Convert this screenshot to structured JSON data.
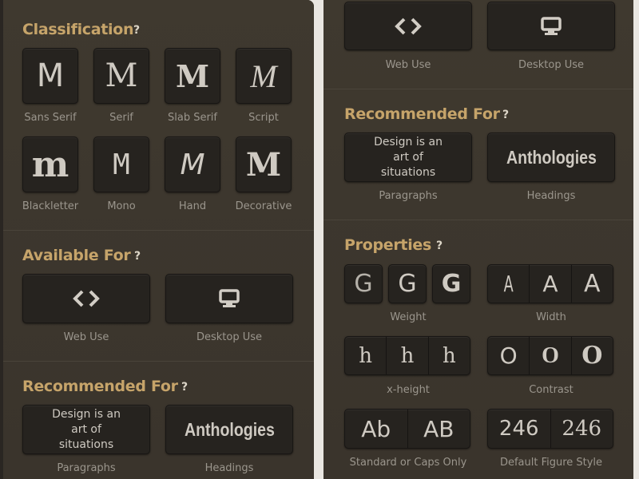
{
  "left": {
    "classification": {
      "title": "Classification",
      "help": "?",
      "items": [
        {
          "glyph": "M",
          "label": "Sans Serif"
        },
        {
          "glyph": "M",
          "label": "Serif"
        },
        {
          "glyph": "M",
          "label": "Slab Serif"
        },
        {
          "glyph": "M",
          "label": "Script"
        },
        {
          "glyph": "m",
          "label": "Blackletter"
        },
        {
          "glyph": "M",
          "label": "Mono"
        },
        {
          "glyph": "M",
          "label": "Hand"
        },
        {
          "glyph": "M",
          "label": "Decorative"
        }
      ]
    },
    "available": {
      "title": "Available For",
      "help": "?",
      "web": "Web Use",
      "desktop": "Desktop Use"
    },
    "recommended": {
      "title": "Recommended For",
      "help": "?",
      "para_sample": "Design is an art of situations",
      "para": "Paragraphs",
      "head_sample": "Anthologies",
      "head": "Headings"
    }
  },
  "right": {
    "available": {
      "web": "Web Use",
      "desktop": "Desktop Use"
    },
    "recommended": {
      "title": "Recommended For",
      "help": "?",
      "para_sample": "Design is an art of situations",
      "para": "Paragraphs",
      "head_sample": "Anthologies",
      "head": "Headings"
    },
    "properties": {
      "title": "Properties",
      "help": "?",
      "weight": {
        "label": "Weight",
        "glyphs": [
          "G",
          "G",
          "G"
        ]
      },
      "width": {
        "label": "Width",
        "glyphs": [
          "A",
          "A",
          "A"
        ]
      },
      "xheight": {
        "label": "x-height",
        "glyphs": [
          "h",
          "h",
          "h"
        ]
      },
      "contrast": {
        "label": "Contrast",
        "glyphs": [
          "O",
          "O",
          "O"
        ]
      },
      "caps": {
        "label": "Standard or Caps Only",
        "glyphs": [
          "Ab",
          "AB"
        ]
      },
      "figures": {
        "label": "Default Figure Style",
        "glyphs": [
          "246",
          "246"
        ]
      }
    }
  },
  "icons": {
    "web": "code-brackets-icon",
    "desktop": "monitor-icon"
  }
}
